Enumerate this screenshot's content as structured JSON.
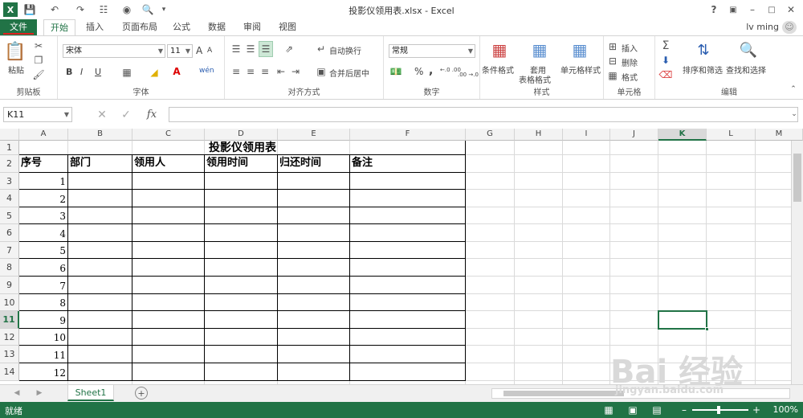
{
  "window": {
    "title": "投影仪领用表.xlsx - Excel",
    "help": "?",
    "user": "lv ming"
  },
  "tabs": [
    "文件",
    "开始",
    "插入",
    "页面布局",
    "公式",
    "数据",
    "审阅",
    "视图"
  ],
  "ribbon": {
    "clipboard": {
      "label": "剪贴板",
      "paste": "粘贴"
    },
    "font": {
      "label": "字体",
      "name": "宋体",
      "size": "11",
      "bold": "B",
      "italic": "I",
      "underline": "U",
      "grow": "A",
      "shrink": "A",
      "phonetic": "wén"
    },
    "alignment": {
      "label": "对齐方式",
      "wrap": "自动换行",
      "merge": "合并后居中"
    },
    "number": {
      "label": "数字",
      "format": "常规",
      "percent": "%",
      "comma": ",",
      "inc": "←.0 .00",
      "dec": ".00 →.0"
    },
    "styles": {
      "label": "样式",
      "conditional": "条件格式",
      "table_1": "套用",
      "table_2": "表格格式",
      "cell": "单元格样式"
    },
    "cells": {
      "label": "单元格",
      "insert": "插入",
      "delete": "删除",
      "format": "格式"
    },
    "editing": {
      "label": "编辑",
      "sort": "排序和筛选",
      "find": "查找和选择"
    }
  },
  "formula_bar": {
    "namebox": "K11",
    "fx": "fx",
    "value": ""
  },
  "columns": [
    "A",
    "B",
    "C",
    "D",
    "E",
    "F",
    "G",
    "H",
    "I",
    "J",
    "K",
    "L",
    "M"
  ],
  "rows": [
    "1",
    "2",
    "3",
    "4",
    "5",
    "6",
    "7",
    "8",
    "9",
    "10",
    "11",
    "12",
    "13",
    "14"
  ],
  "table": {
    "title": "投影仪领用表",
    "headers": [
      "序号",
      "部门",
      "领用人",
      "领用时间",
      "归还时间",
      "备注"
    ],
    "numbers": [
      "1",
      "2",
      "3",
      "4",
      "5",
      "6",
      "7",
      "8",
      "9",
      "10",
      "11",
      "12"
    ]
  },
  "sheet_tabs": {
    "active": "Sheet1",
    "add": "+"
  },
  "status": {
    "ready": "就绪",
    "zoom": "100%"
  },
  "watermark": {
    "brand": "Bai 经验",
    "url": "jingyan.baidu.com"
  }
}
